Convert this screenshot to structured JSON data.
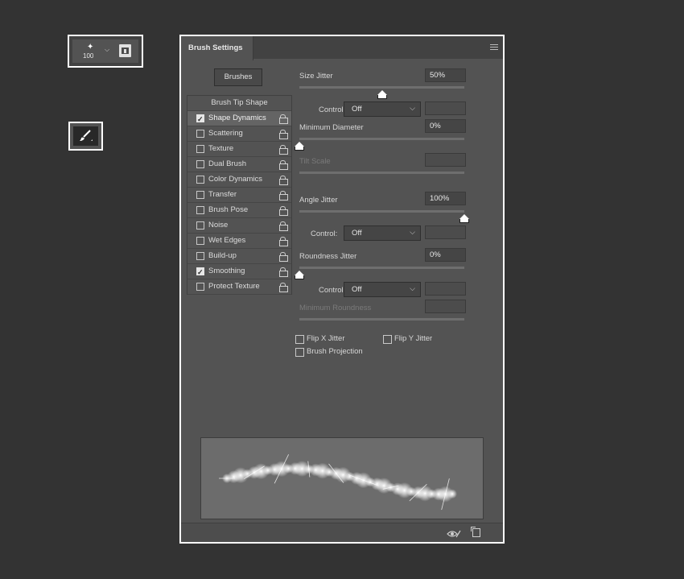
{
  "preset": {
    "size": "100",
    "icons": [
      "brush-preview-icon",
      "chevron-down-icon",
      "preset-folder-icon"
    ]
  },
  "tool": {
    "icon": "brush-tool-icon"
  },
  "panel": {
    "title": "Brush Settings",
    "menu_icon": "hamburger-menu-icon"
  },
  "brushes_button": "Brushes",
  "left_list": {
    "header": "Brush Tip Shape",
    "items": [
      {
        "label": "Shape Dynamics",
        "checked": true,
        "active": true
      },
      {
        "label": "Scattering",
        "checked": false
      },
      {
        "label": "Texture",
        "checked": false
      },
      {
        "label": "Dual Brush",
        "checked": false
      },
      {
        "label": "Color Dynamics",
        "checked": false
      },
      {
        "label": "Transfer",
        "checked": false
      },
      {
        "label": "Brush Pose",
        "checked": false
      },
      {
        "label": "Noise",
        "checked": false
      },
      {
        "label": "Wet Edges",
        "checked": false
      },
      {
        "label": "Build-up",
        "checked": false
      },
      {
        "label": "Smoothing",
        "checked": true
      },
      {
        "label": "Protect Texture",
        "checked": false
      }
    ]
  },
  "settings": {
    "size_jitter": {
      "label": "Size Jitter",
      "value": "50%",
      "fraction": 0.5
    },
    "control1": {
      "label": "Control:",
      "value": "Off"
    },
    "min_diameter": {
      "label": "Minimum Diameter",
      "value": "0%",
      "fraction": 0
    },
    "tilt_scale": {
      "label": "Tilt Scale",
      "value": ""
    },
    "angle_jitter": {
      "label": "Angle Jitter",
      "value": "100%",
      "fraction": 1
    },
    "control2": {
      "label": "Control:",
      "value": "Off"
    },
    "roundness_jitter": {
      "label": "Roundness Jitter",
      "value": "0%",
      "fraction": 0
    },
    "control3": {
      "label": "Control:",
      "value": "Off"
    },
    "min_roundness": {
      "label": "Minimum Roundness",
      "value": ""
    }
  },
  "checkboxes": {
    "flip_x": "Flip X Jitter",
    "flip_y": "Flip Y Jitter",
    "brush_projection": "Brush Projection"
  },
  "footer": {
    "icons": [
      "eye-toggle-icon",
      "new-brush-icon"
    ]
  }
}
